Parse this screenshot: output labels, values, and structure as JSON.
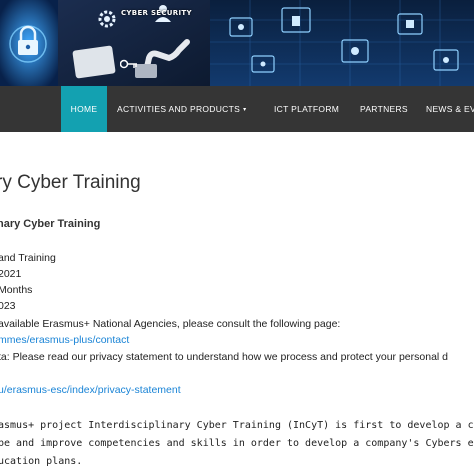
{
  "banner": {
    "label": "CYBER SECURITY",
    "icons": [
      "lock-icon",
      "hand-touch-icon",
      "key-icon",
      "user-icon",
      "gear-icon",
      "network-icon"
    ]
  },
  "nav": {
    "items": [
      {
        "label": "HOME",
        "active": true
      },
      {
        "label": "ACTIVITIES AND PRODUCTS",
        "dropdown": true
      },
      {
        "label": "ICT PLATFORM"
      },
      {
        "label": "PARTNERS"
      },
      {
        "label": "NEWS & EV"
      }
    ],
    "dropdown_caret": "▾"
  },
  "content": {
    "title": "ry Cyber Training",
    "subtitle": "nary Cyber Training",
    "lines": [
      "and Training",
      "2021",
      " Months",
      "023",
      " available Erasmus+ National Agencies, please consult the following page:",
      "mmes/erasmus-plus/contact",
      "ta: Please read our privacy statement to understand how we process and protect your personal d",
      "u/erasmus-esc/index/privacy-statement",
      "asmus+ project Interdisciplinary Cyber Training (InCyT) is first to develop a cybersecurity comp",
      "pe and improve competencies and skills in order to develop a company's Cybers ecurity strategy a",
      "ucation plans."
    ]
  },
  "colors": {
    "nav_bg": "#353535",
    "nav_active": "#13a1b1",
    "link": "#1a84d6",
    "banner_bg": "#0b1b33"
  }
}
